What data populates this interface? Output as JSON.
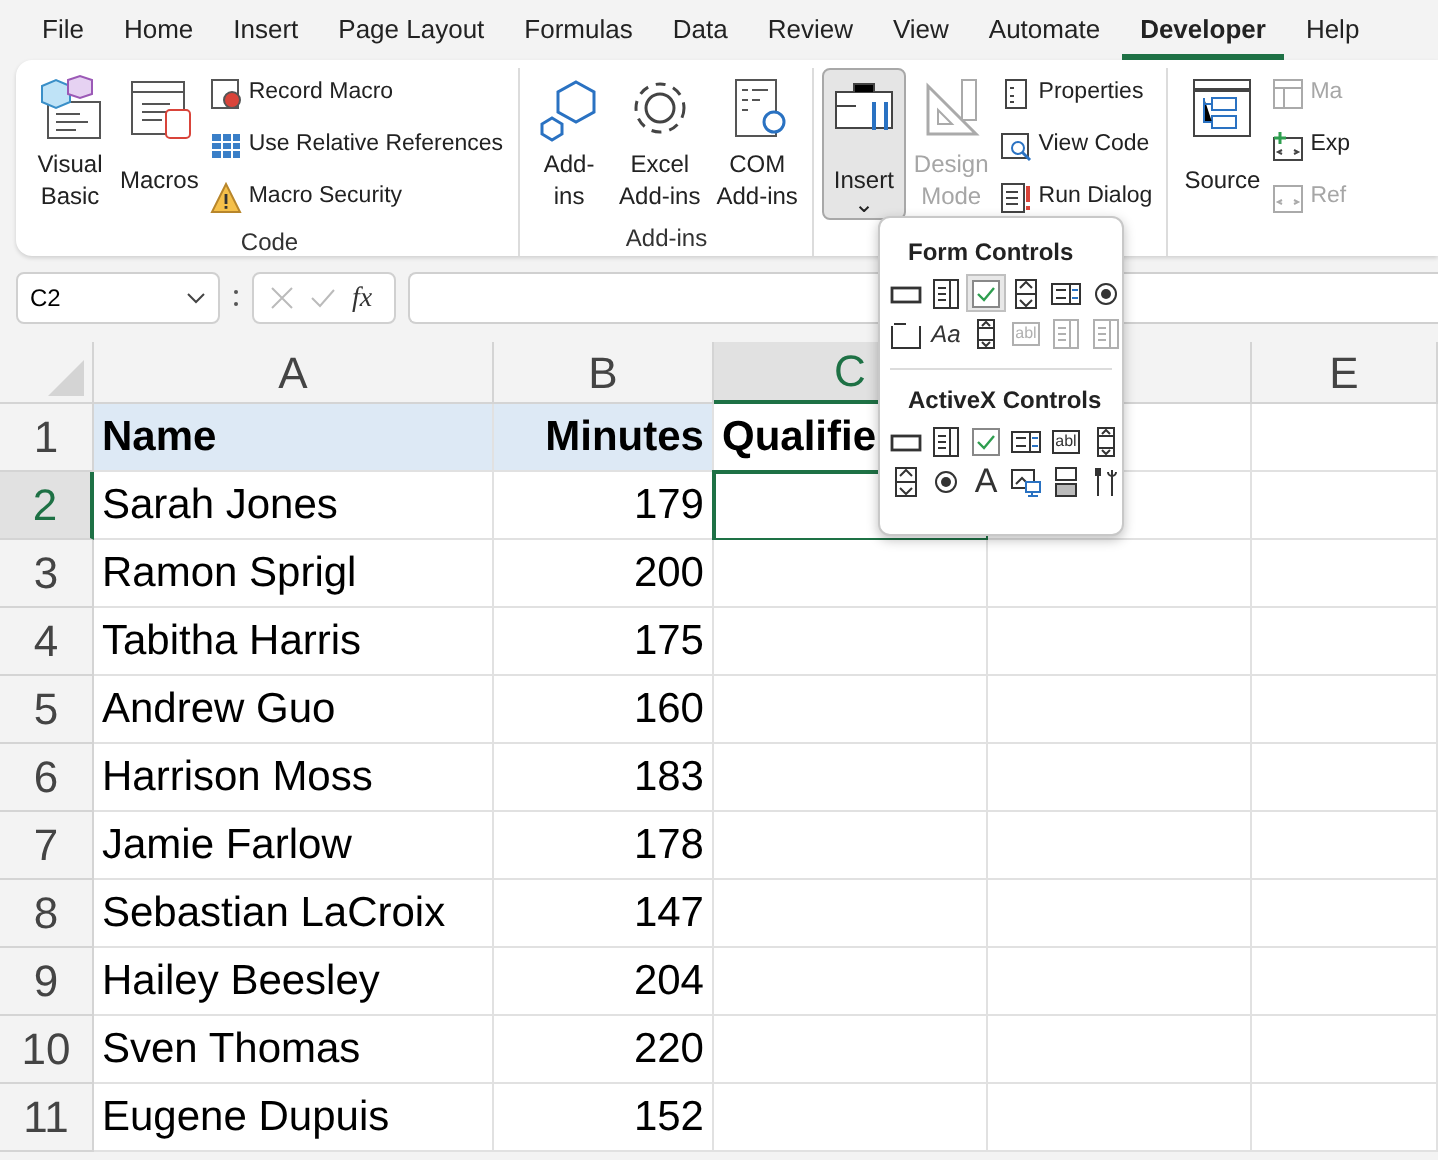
{
  "menu_tabs": [
    {
      "label": "File",
      "selected": false
    },
    {
      "label": "Home",
      "selected": false
    },
    {
      "label": "Insert",
      "selected": false
    },
    {
      "label": "Page Layout",
      "selected": false
    },
    {
      "label": "Formulas",
      "selected": false
    },
    {
      "label": "Data",
      "selected": false
    },
    {
      "label": "Review",
      "selected": false
    },
    {
      "label": "View",
      "selected": false
    },
    {
      "label": "Automate",
      "selected": false
    },
    {
      "label": "Developer",
      "selected": true
    },
    {
      "label": "Help",
      "selected": false
    }
  ],
  "ribbon_groups": [
    {
      "label": "Code",
      "items": [
        {
          "kind": "large",
          "lines": [
            "Visual",
            "Basic"
          ],
          "disabled": false,
          "pressed": false
        },
        {
          "kind": "large",
          "lines": [
            "Macros"
          ],
          "disabled": false,
          "pressed": false
        },
        {
          "kind": "stack",
          "items": [
            {
              "label": "Record Macro",
              "disabled": false
            },
            {
              "label": "Use Relative References",
              "disabled": false
            },
            {
              "label": "Macro Security",
              "disabled": false
            }
          ]
        }
      ]
    },
    {
      "label": "Add-ins",
      "items": [
        {
          "kind": "large",
          "lines": [
            "Add-",
            "ins"
          ],
          "disabled": false,
          "pressed": false
        },
        {
          "kind": "large",
          "lines": [
            "Excel",
            "Add-ins"
          ],
          "disabled": false,
          "pressed": false
        },
        {
          "kind": "large",
          "lines": [
            "COM",
            "Add-ins"
          ],
          "disabled": false,
          "pressed": false
        }
      ]
    },
    {
      "items": [
        {
          "kind": "large",
          "lines": [
            "Insert"
          ],
          "caret": "⌄",
          "disabled": false,
          "pressed": true
        },
        {
          "kind": "large",
          "lines": [
            "Design",
            "Mode"
          ],
          "disabled": true,
          "pressed": false
        },
        {
          "kind": "stack",
          "items": [
            {
              "label": "Properties",
              "disabled": false
            },
            {
              "label": "View Code",
              "disabled": false
            },
            {
              "label": "Run Dialog",
              "disabled": false
            }
          ]
        }
      ]
    },
    {
      "items": [
        {
          "kind": "large",
          "lines": [
            "Source"
          ],
          "disabled": false,
          "pressed": false
        },
        {
          "kind": "stack",
          "items": [
            {
              "label": "Ma",
              "disabled": true
            },
            {
              "label": "Exp",
              "disabled": false
            },
            {
              "label": "Ref",
              "disabled": true
            }
          ]
        }
      ]
    }
  ],
  "formula_bar": {
    "name_box": "C2",
    "fx_label": "fx",
    "cancel_disabled": true
  },
  "columns": [
    {
      "label": "A",
      "selected": false
    },
    {
      "label": "B",
      "selected": false
    },
    {
      "label": "C",
      "selected": true
    },
    {
      "selected": false
    },
    {
      "label": "E",
      "selected": false
    }
  ],
  "rows": [
    {
      "label": "1",
      "selected": false,
      "cells": [
        "Name",
        "Minutes",
        "Qualifie"
      ]
    },
    {
      "label": "2",
      "selected": true,
      "cells": [
        "Sarah Jones",
        "179"
      ]
    },
    {
      "label": "3",
      "selected": false,
      "cells": [
        "Ramon Sprigl",
        "200"
      ]
    },
    {
      "label": "4",
      "selected": false,
      "cells": [
        "Tabitha Harris",
        "175"
      ]
    },
    {
      "label": "5",
      "selected": false,
      "cells": [
        "Andrew Guo",
        "160"
      ]
    },
    {
      "label": "6",
      "selected": false,
      "cells": [
        "Harrison Moss",
        "183"
      ]
    },
    {
      "label": "7",
      "selected": false,
      "cells": [
        "Jamie Farlow",
        "178"
      ]
    },
    {
      "label": "8",
      "selected": false,
      "cells": [
        "Sebastian LaCroix",
        "147"
      ]
    },
    {
      "label": "9",
      "selected": false,
      "cells": [
        "Hailey Beesley",
        "204"
      ]
    },
    {
      "label": "10",
      "selected": false,
      "cells": [
        "Sven Thomas",
        "220"
      ]
    },
    {
      "label": "11",
      "selected": false,
      "cells": [
        "Eugene Dupuis",
        "152"
      ]
    }
  ],
  "insert_menu": {
    "sections": [
      {
        "title": "Form Controls",
        "items": [
          {
            "kind": "button",
            "disabled": false,
            "hovered": false
          },
          {
            "kind": "combo",
            "disabled": false,
            "hovered": false
          },
          {
            "kind": "checkbox",
            "disabled": false,
            "hovered": true
          },
          {
            "kind": "spin",
            "disabled": false,
            "hovered": false
          },
          {
            "kind": "listbox",
            "disabled": false,
            "hovered": false
          },
          {
            "kind": "option",
            "disabled": false,
            "hovered": false
          },
          {
            "kind": "group",
            "disabled": false,
            "hovered": false
          },
          {
            "kind": "label",
            "glyph": "Aa",
            "disabled": false,
            "hovered": false
          },
          {
            "kind": "scrollbar",
            "disabled": false,
            "hovered": false
          },
          {
            "kind": "textfield",
            "glyph": "abl",
            "disabled": true,
            "hovered": false
          },
          {
            "kind": "combo",
            "disabled": true,
            "hovered": false
          },
          {
            "kind": "combo",
            "disabled": true,
            "hovered": false
          }
        ]
      },
      {
        "title": "ActiveX Controls",
        "items": [
          {
            "kind": "button",
            "disabled": false
          },
          {
            "kind": "combo",
            "disabled": false
          },
          {
            "kind": "checkbox",
            "disabled": false
          },
          {
            "kind": "listbox",
            "disabled": false
          },
          {
            "kind": "textfield",
            "glyph": "abl",
            "disabled": false
          },
          {
            "kind": "scrollbar",
            "disabled": false
          },
          {
            "kind": "spin",
            "disabled": false
          },
          {
            "kind": "option",
            "disabled": false
          },
          {
            "kind": "label",
            "glyph": "A",
            "disabled": false
          },
          {
            "kind": "image",
            "disabled": false
          },
          {
            "kind": "toggle",
            "disabled": false
          },
          {
            "kind": "tools",
            "disabled": false
          }
        ]
      }
    ]
  }
}
